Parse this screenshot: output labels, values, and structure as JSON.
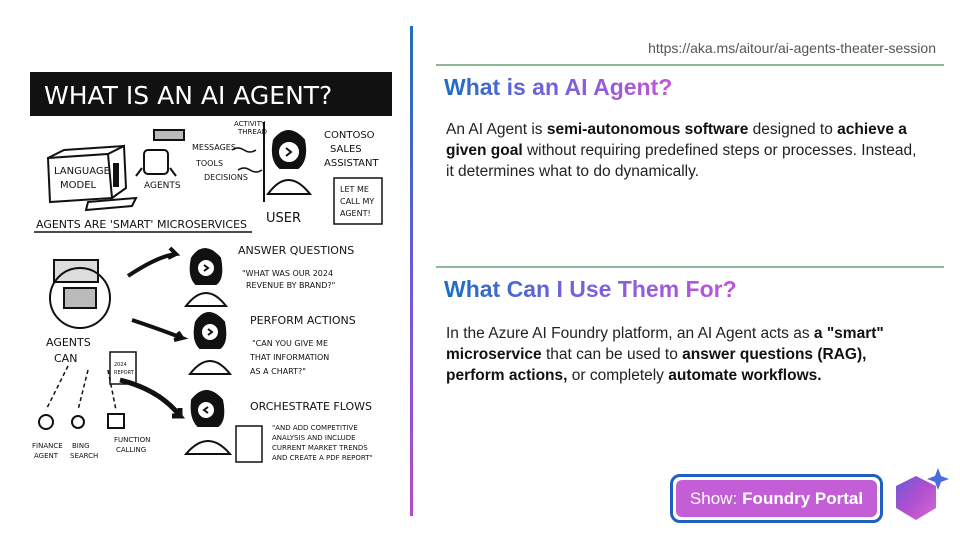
{
  "url": "https://aka.ms/aitour/ai-agents-theater-session",
  "section1": {
    "heading": "What is an AI Agent?",
    "parts": [
      {
        "text": "An AI Agent is ",
        "bold": false
      },
      {
        "text": "semi-autonomous software",
        "bold": true
      },
      {
        "text": " designed to ",
        "bold": false
      },
      {
        "text": "achieve a given goal",
        "bold": true
      },
      {
        "text": " without requiring predefined steps or processes. Instead, it determines what to do dynamically.",
        "bold": false
      }
    ]
  },
  "section2": {
    "heading": "What Can I Use Them For?",
    "parts": [
      {
        "text": "In the Azure AI Foundry platform, an AI Agent acts as ",
        "bold": false
      },
      {
        "text": "a \"smart\" microservice",
        "bold": true
      },
      {
        "text": " that can be used to ",
        "bold": false
      },
      {
        "text": "answer questions (RAG),",
        "bold": true
      },
      {
        "text": " ",
        "bold": false
      },
      {
        "text": "perform actions,",
        "bold": true
      },
      {
        "text": " or completely ",
        "bold": false
      },
      {
        "text": "automate workflows.",
        "bold": true
      }
    ]
  },
  "show_button": {
    "prefix": "Show:",
    "label": "Foundry Portal"
  },
  "sketch": {
    "title": "WHAT IS AN AI AGENT?",
    "language_model": "LANGUAGE MODEL",
    "agents": "AGENTS",
    "messages": "MESSAGES",
    "tools": "TOOLS",
    "decisions": "DECISIONS",
    "activity_thread": "ACTIVITY THREAD",
    "assistant": "CONTOSO SALES ASSISTANT",
    "user_bubble": "LET ME CALL MY AGENT!",
    "microservices": "AGENTS ARE 'SMART' MICROSERVICES",
    "user": "USER",
    "agents_can": "AGENTS CAN",
    "answer_questions": "ANSWER QUESTIONS",
    "answer_quote": "\"WHAT WAS OUR 2024 REVENUE BY BRAND?\"",
    "perform_actions": "PERFORM ACTIONS",
    "perform_quote": "\"CAN YOU GIVE ME THAT INFORMATION AS A CHART?\"",
    "orchestrate": "ORCHESTRATE FLOWS",
    "orchestrate_quote": "\"AND ADD COMPETITIVE ANALYSIS AND INCLUDE CURRENT MARKET TRENDS AND CREATE A PDF REPORT\"",
    "report": "2024 REVENUE REPORT",
    "finance_agent": "FINANCE AGENT",
    "bing_search": "BING SEARCH",
    "function_calling": "FUNCTION CALLING"
  }
}
